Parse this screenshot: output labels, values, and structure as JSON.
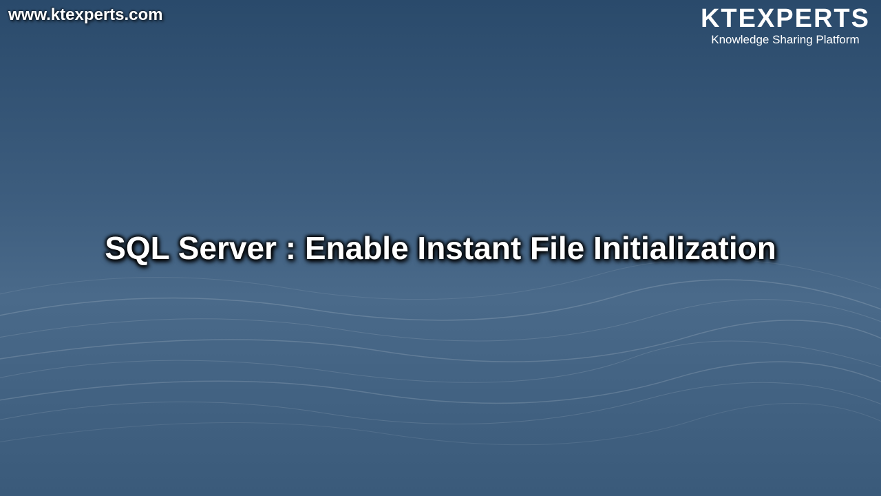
{
  "header": {
    "website_url": "www.ktexperts.com",
    "brand_name": "KTEXPERTS",
    "brand_tagline": "Knowledge Sharing Platform"
  },
  "content": {
    "title": "SQL Server : Enable Instant File Initialization"
  }
}
